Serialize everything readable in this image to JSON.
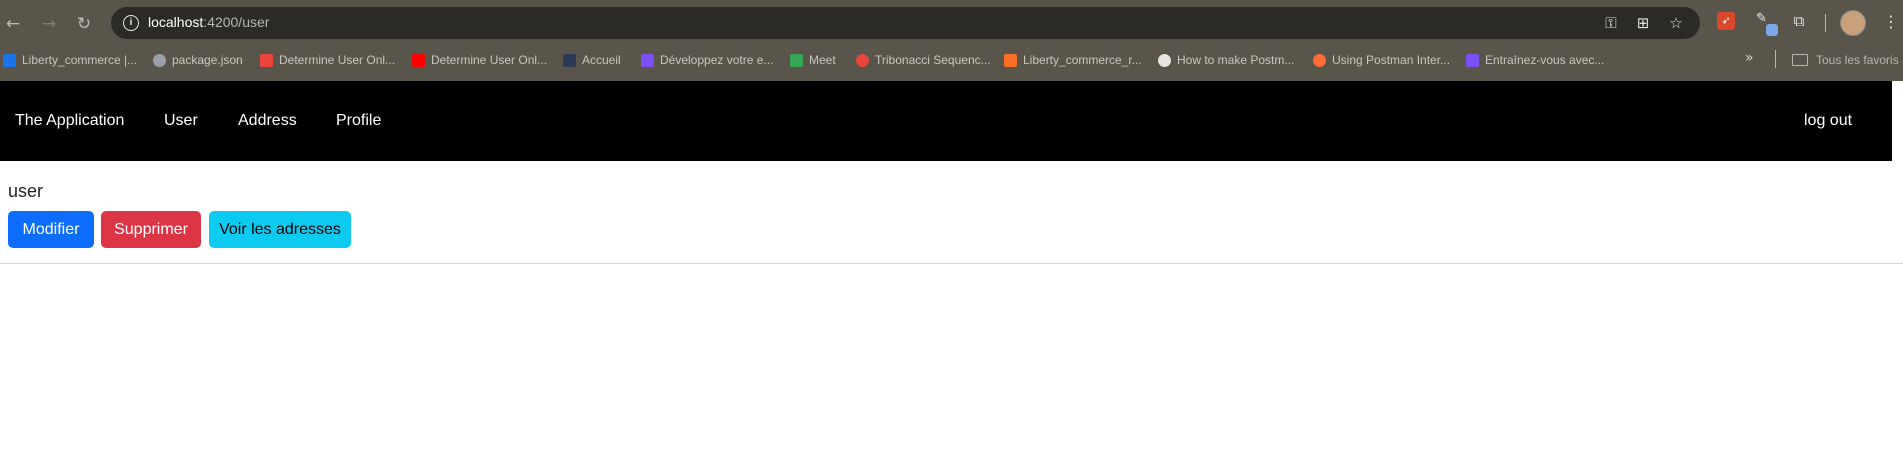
{
  "browser": {
    "url_host": "localhost",
    "url_rest": ":4200/user",
    "bookmarks": [
      {
        "label": "Liberty_commerce |...",
        "color": "#1a73e8"
      },
      {
        "label": "package.json",
        "color": "#9aa0a6"
      },
      {
        "label": "Determine User Onl...",
        "color": "#e8453c"
      },
      {
        "label": "Determine User Onl...",
        "color": "#ff0000"
      },
      {
        "label": "Accueil",
        "color": "#2b3a55"
      },
      {
        "label": "Développez votre e...",
        "color": "#7b4ff5"
      },
      {
        "label": "Meet",
        "color": "#34a853"
      },
      {
        "label": "Tribonacci Sequenc...",
        "color": "#e8453c"
      },
      {
        "label": "Liberty_commerce_r...",
        "color": "#fc6d26"
      },
      {
        "label": "How to make Postm...",
        "color": "#e6e4df"
      },
      {
        "label": "Using Postman Inter...",
        "color": "#ff6c37"
      },
      {
        "label": "Entraînez-vous avec...",
        "color": "#7b4ff5"
      }
    ],
    "all_bookmarks": "Tous les favoris"
  },
  "appnav": {
    "brand": "The Application",
    "links": [
      "User",
      "Address",
      "Profile"
    ],
    "logout": "log out"
  },
  "main": {
    "title": "user",
    "buttons": {
      "modify": "Modifier",
      "delete": "Supprimer",
      "addresses": "Voir les adresses"
    }
  }
}
